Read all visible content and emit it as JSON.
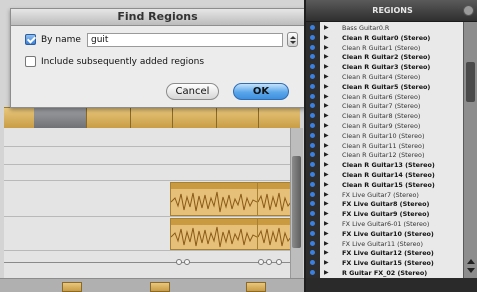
{
  "dialog": {
    "title": "Find Regions",
    "by_name_label": "By name",
    "by_name_checked": true,
    "search_value": "guit",
    "include_label": "Include subsequently added regions",
    "include_checked": false,
    "cancel_label": "Cancel",
    "ok_label": "OK"
  },
  "regions": {
    "header": "REGIONS",
    "items": [
      {
        "name": "Bass Guitar0.R",
        "bold": false
      },
      {
        "name": "Clean R Guitar0 (Stereo)",
        "bold": true
      },
      {
        "name": "Clean R Guitar1 (Stereo)",
        "bold": false
      },
      {
        "name": "Clean R Guitar2 (Stereo)",
        "bold": true
      },
      {
        "name": "Clean R Guitar3 (Stereo)",
        "bold": true
      },
      {
        "name": "Clean R Guitar4 (Stereo)",
        "bold": false
      },
      {
        "name": "Clean R Guitar5 (Stereo)",
        "bold": true
      },
      {
        "name": "Clean R Guitar6 (Stereo)",
        "bold": false
      },
      {
        "name": "Clean R Guitar7 (Stereo)",
        "bold": false
      },
      {
        "name": "Clean R Guitar8 (Stereo)",
        "bold": false
      },
      {
        "name": "Clean R Guitar9 (Stereo)",
        "bold": false
      },
      {
        "name": "Clean R Guitar10 (Stereo)",
        "bold": false
      },
      {
        "name": "Clean R Guitar11 (Stereo)",
        "bold": false
      },
      {
        "name": "Clean R Guitar12 (Stereo)",
        "bold": false
      },
      {
        "name": "Clean R Guitar13 (Stereo)",
        "bold": true
      },
      {
        "name": "Clean R Guitar14 (Stereo)",
        "bold": true
      },
      {
        "name": "Clean R Guitar15 (Stereo)",
        "bold": true
      },
      {
        "name": "FX Live Guitar7 (Stereo)",
        "bold": false
      },
      {
        "name": "FX Live Guitar8 (Stereo)",
        "bold": true
      },
      {
        "name": "FX Live Guitar9 (Stereo)",
        "bold": true
      },
      {
        "name": "FX Live Guitar6-01 (Stereo)",
        "bold": false
      },
      {
        "name": "FX Live Guitar10 (Stereo)",
        "bold": true
      },
      {
        "name": "FX Live Guitar11 (Stereo)",
        "bold": false
      },
      {
        "name": "FX Live Guitar12 (Stereo)",
        "bold": true
      },
      {
        "name": "FX Live Guitar15 (Stereo)",
        "bold": true
      },
      {
        "name": "R Guitar FX_02 (Stereo)",
        "bold": true
      }
    ]
  },
  "colors": {
    "accent_blue": "#3b7fe0",
    "clip_gold": "#e6c078",
    "panel_dark": "#3c3c3c"
  }
}
